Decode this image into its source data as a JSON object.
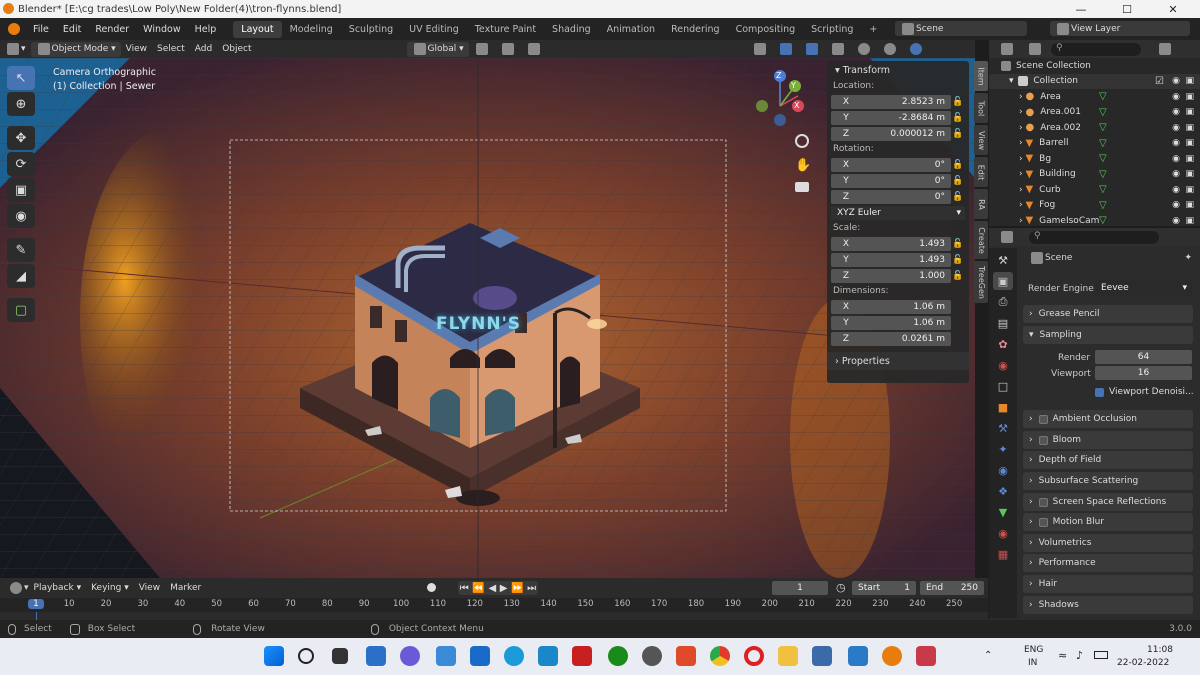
{
  "window": {
    "title": "Blender* [E:\\cg trades\\Low Poly\\New Folder(4)\\tron-flynns.blend]"
  },
  "menus": [
    "File",
    "Edit",
    "Render",
    "Window",
    "Help"
  ],
  "workspaces": [
    "Layout",
    "Modeling",
    "Sculpting",
    "UV Editing",
    "Texture Paint",
    "Shading",
    "Animation",
    "Rendering",
    "Compositing",
    "Scripting"
  ],
  "active_workspace": "Layout",
  "scene_field": "Scene",
  "view_layer_field": "View Layer",
  "header": {
    "mode": "Object Mode",
    "view": "View",
    "select": "Select",
    "add": "Add",
    "object": "Object",
    "orientation": "Global"
  },
  "viewport": {
    "line1": "Camera Orthographic",
    "line2": "(1) Collection | Sewer",
    "sign": "FLYNN'S",
    "gizmo": {
      "x": "X",
      "y": "Y",
      "z": "Z"
    }
  },
  "npanel": {
    "title": "Transform",
    "location_label": "Location:",
    "location": [
      {
        "k": "X",
        "v": "2.8523 m"
      },
      {
        "k": "Y",
        "v": "-2.8684 m"
      },
      {
        "k": "Z",
        "v": "0.000012 m"
      }
    ],
    "rotation_label": "Rotation:",
    "rotation": [
      {
        "k": "X",
        "v": "0°"
      },
      {
        "k": "Y",
        "v": "0°"
      },
      {
        "k": "Z",
        "v": "0°"
      }
    ],
    "rotation_mode": "XYZ Euler",
    "scale_label": "Scale:",
    "scale": [
      {
        "k": "X",
        "v": "1.493"
      },
      {
        "k": "Y",
        "v": "1.493"
      },
      {
        "k": "Z",
        "v": "1.000"
      }
    ],
    "dimensions_label": "Dimensions:",
    "dimensions": [
      {
        "k": "X",
        "v": "1.06 m"
      },
      {
        "k": "Y",
        "v": "1.06 m"
      },
      {
        "k": "Z",
        "v": "0.0261 m"
      }
    ],
    "properties": "Properties"
  },
  "side_tabs": [
    "Item",
    "Tool",
    "View",
    "Edit",
    "RA",
    "Create",
    "TreeGen"
  ],
  "outliner": {
    "scene_collection": "Scene Collection",
    "collection": "Collection",
    "items": [
      "Area",
      "Area.001",
      "Area.002",
      "Barrell",
      "Bg",
      "Building",
      "Curb",
      "Fog",
      "GameIsoCam"
    ]
  },
  "properties": {
    "scene": "Scene",
    "render_engine_label": "Render Engine",
    "render_engine": "Eevee",
    "sections": [
      "Grease Pencil",
      "Sampling",
      "Ambient Occlusion",
      "Bloom",
      "Depth of Field",
      "Subsurface Scattering",
      "Screen Space Reflections",
      "Motion Blur",
      "Volumetrics",
      "Performance",
      "Hair",
      "Shadows"
    ],
    "render_label": "Render",
    "render_value": "64",
    "viewport_label": "Viewport",
    "viewport_value": "16",
    "viewport_denoising": "Viewport Denoisi..."
  },
  "timeline": {
    "playback": "Playback",
    "keying": "Keying",
    "view": "View",
    "marker": "Marker",
    "current_frame": "1",
    "start_label": "Start",
    "start": "1",
    "end_label": "End",
    "end": "250",
    "ruler": [
      "1",
      "10",
      "20",
      "30",
      "40",
      "50",
      "60",
      "70",
      "80",
      "90",
      "100",
      "110",
      "120",
      "130",
      "140",
      "150",
      "160",
      "170",
      "180",
      "190",
      "200",
      "210",
      "220",
      "230",
      "240",
      "250"
    ]
  },
  "status": {
    "select": "Select",
    "box_select": "Box Select",
    "rotate_view": "Rotate View",
    "context_menu": "Object Context Menu",
    "version": "3.0.0"
  },
  "taskbar": {
    "lang1": "ENG",
    "lang2": "IN",
    "time": "11:08",
    "date": "22-02-2022"
  }
}
